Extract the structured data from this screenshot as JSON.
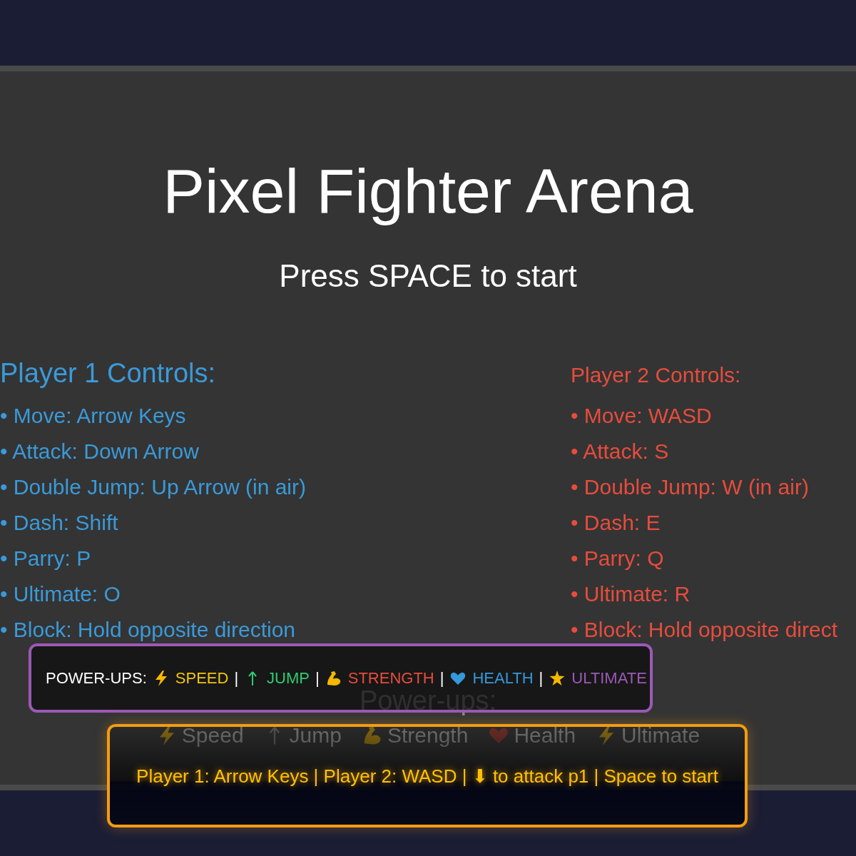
{
  "title": "Pixel Fighter Arena",
  "subtitle": "Press SPACE to start",
  "players": [
    {
      "heading": "Player 1 Controls:",
      "color": "#3a9ad9",
      "bullet": "•",
      "items": [
        "Move: Arrow Keys",
        "Attack: Down Arrow",
        "Double Jump: Up Arrow (in air)",
        "Dash: Shift",
        "Parry: P",
        "Ultimate: O",
        "Block: Hold opposite direction"
      ]
    },
    {
      "heading": "Player 2 Controls:",
      "color": "#e74c3c",
      "bullet": "•",
      "items": [
        "Move: WASD",
        "Attack: S",
        "Double Jump: W (in air)",
        "Dash: E",
        "Parry: Q",
        "Ultimate: R",
        "Block: Hold opposite direct"
      ]
    }
  ],
  "powerups_heading": "Power-ups:",
  "powerup_legend": [
    {
      "kind": "bolt",
      "label": "Speed"
    },
    {
      "kind": "arrow",
      "label": "Jump"
    },
    {
      "kind": "arm",
      "label": "Strength"
    },
    {
      "kind": "heart",
      "label": "Health"
    },
    {
      "kind": "bolt",
      "label": "Ultimate"
    }
  ],
  "powerup_bar": {
    "label": "POWER-UPS:",
    "items": [
      {
        "kind": "bolt",
        "label": "SPEED",
        "color": "#f1c40f"
      },
      {
        "kind": "arrow",
        "label": "JUMP",
        "color": "#2ecc71",
        "separator": "|"
      },
      {
        "kind": "arm",
        "label": "STRENGTH",
        "color": "#e74c3c",
        "separator": "|"
      },
      {
        "kind": "heart",
        "label": "HEALTH",
        "color": "#3498db",
        "separator": "|"
      },
      {
        "kind": "star",
        "label": "ULTIMATE",
        "color": "#9b59b6",
        "separator": "|"
      }
    ]
  },
  "hint": "Player 1: Arrow Keys | Player 2: WASD | ⬇ to attack p1 | Space to start"
}
